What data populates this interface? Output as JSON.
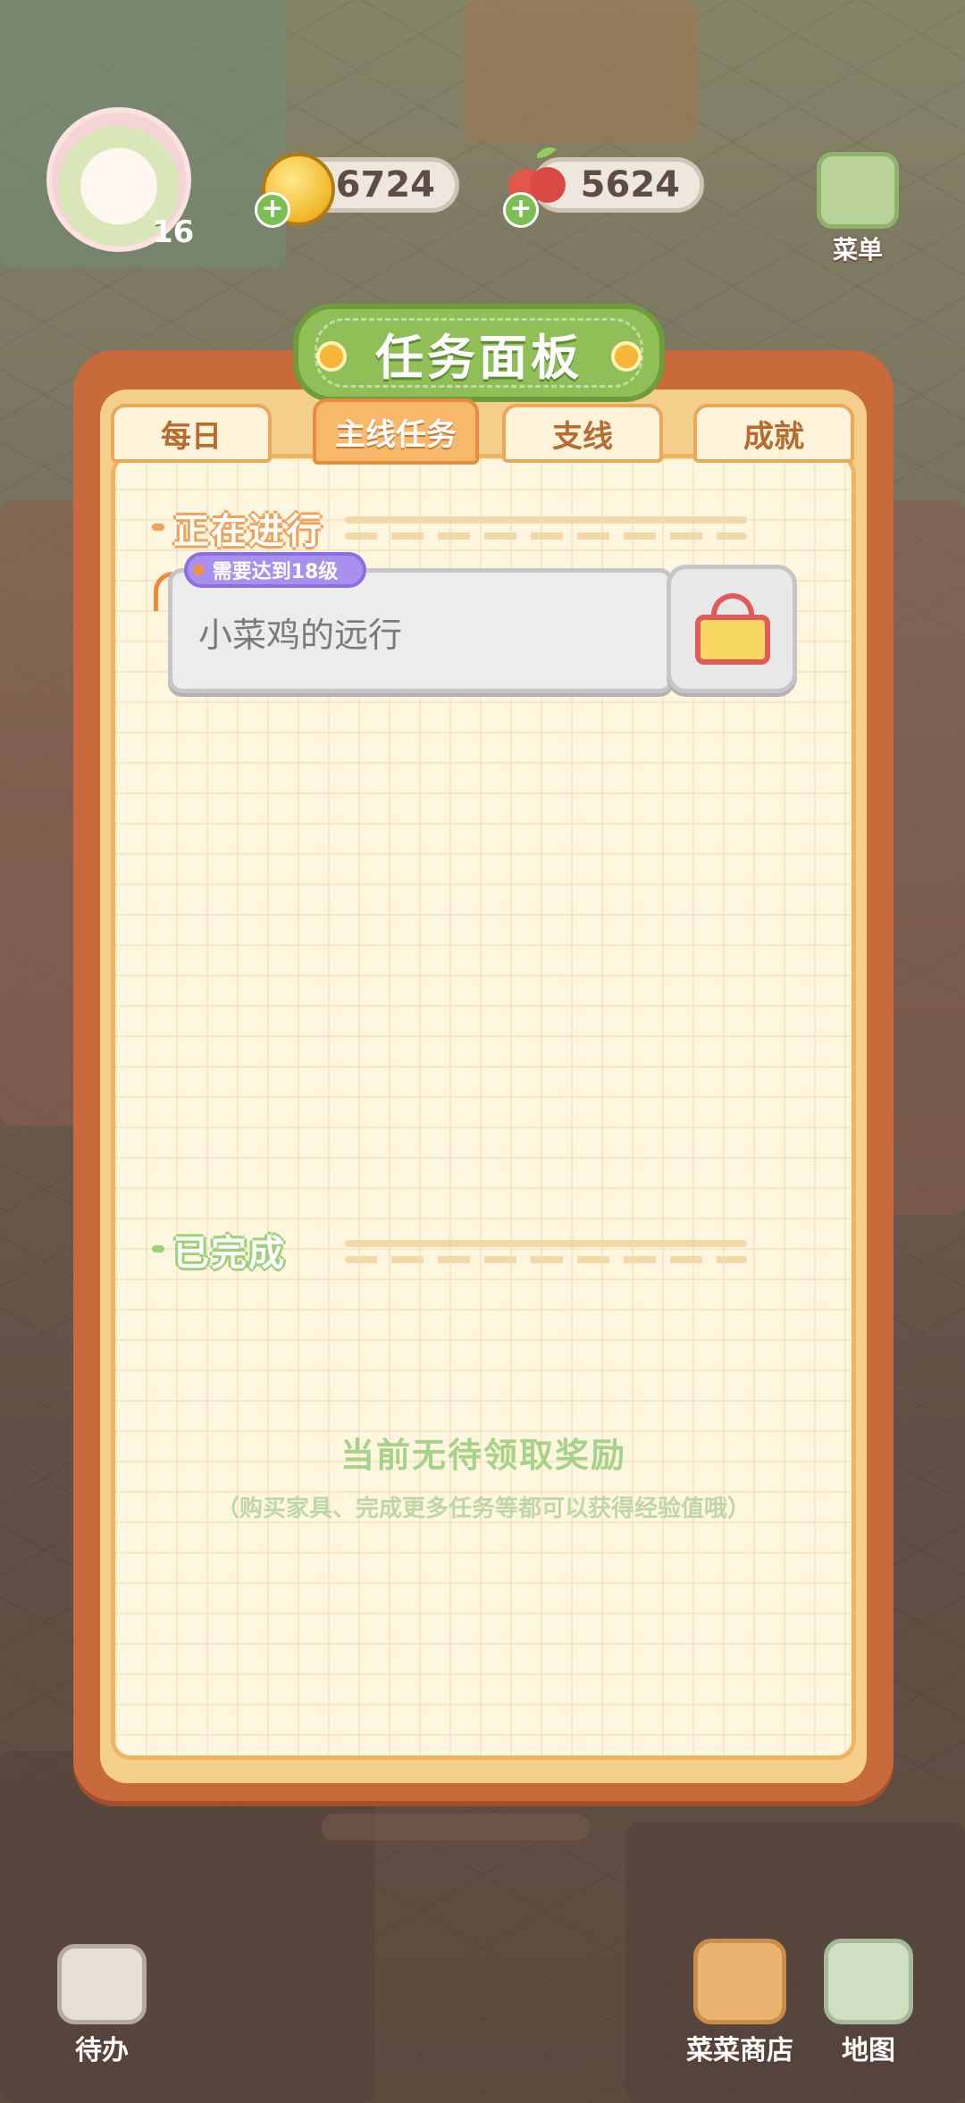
{
  "hud": {
    "level": "16",
    "coins": "36724",
    "berries": "5624",
    "menu_label": "菜单"
  },
  "panel": {
    "title": "任务面板",
    "tabs": [
      {
        "label": "每日",
        "active": false
      },
      {
        "label": "主线任务",
        "active": true
      },
      {
        "label": "支线",
        "active": false
      },
      {
        "label": "成就",
        "active": false
      }
    ]
  },
  "in_progress": {
    "heading": "正在进行",
    "task": {
      "requirement": "需要达到18级",
      "name": "小菜鸡的远行",
      "status_icon": "lock-icon"
    }
  },
  "completed": {
    "heading": "已完成",
    "empty_message": "当前无待领取奖励",
    "empty_hint": "（购买家具、完成更多任务等都可以获得经验值哦）"
  },
  "bottom": {
    "todo_label": "待办",
    "shop_label": "菜菜商店",
    "map_label": "地图"
  },
  "colors": {
    "panel_border": "#c96a3c",
    "banner_green": "#8fbf56",
    "tab_active": "#f7b86a",
    "in_progress_accent": "#f0a25a",
    "completed_accent": "#9dd07a",
    "requirement_tag": "#a890f0"
  }
}
